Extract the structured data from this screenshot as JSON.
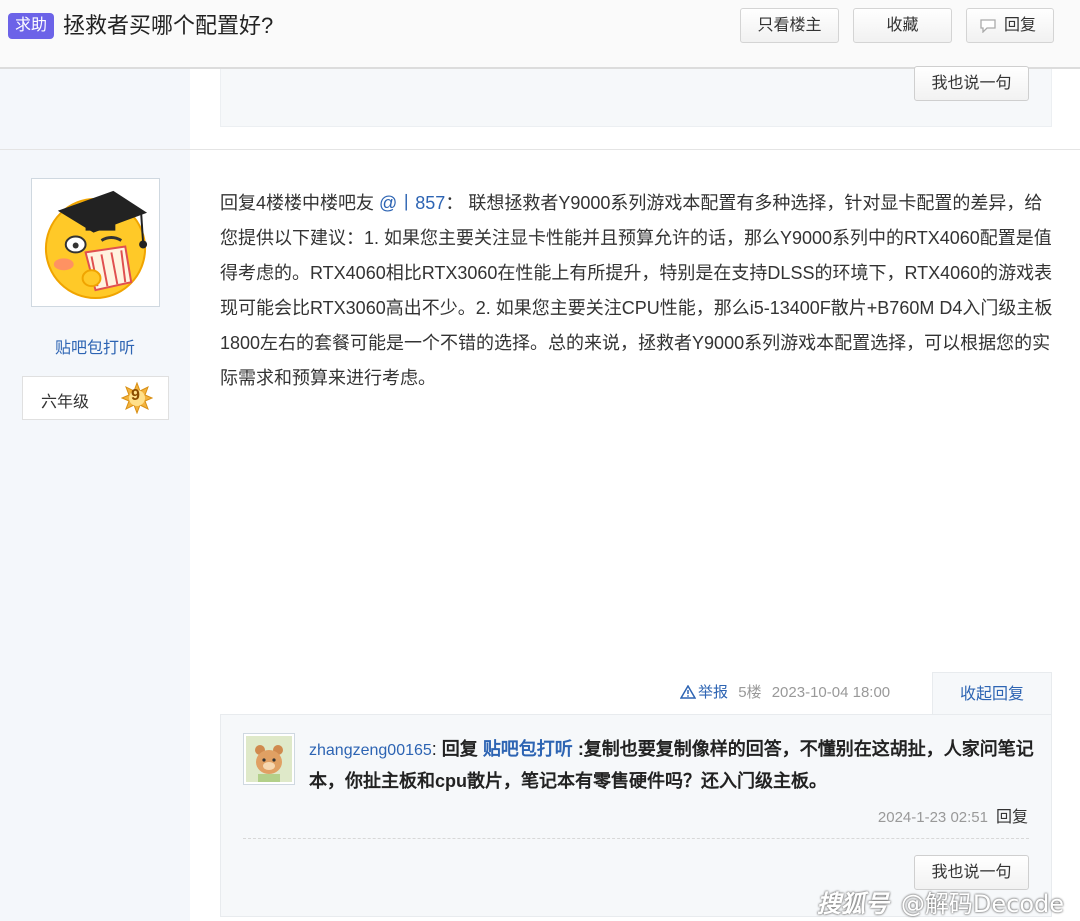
{
  "header": {
    "tag": "求助",
    "title": "拯救者买哪个配置好?",
    "only_op_label": "只看楼主",
    "favorite_label": "收藏",
    "reply_label": "回复"
  },
  "prev_post": {
    "say_label": "我也说一句"
  },
  "post": {
    "author": "贴吧包打听",
    "level_name": "六年级",
    "level_num": "9",
    "content_prefix": "回复4楼楼中楼吧友 ",
    "content_mention": "@丨857",
    "content_body": "： 联想拯救者Y9000系列游戏本配置有多种选择，针对显卡配置的差异，给您提供以下建议：1. 如果您主要关注显卡性能并且预算允许的话，那么Y9000系列中的RTX4060配置是值得考虑的。RTX4060相比RTX3060在性能上有所提升，特别是在支持DLSS的环境下，RTX4060的游戏表现可能会比RTX3060高出不少。2. 如果您主要关注CPU性能，那么i5-13400F散片+B760M D4入门级主板 1800左右的套餐可能是一个不错的选择。总的来说，拯救者Y9000系列游戏本配置选择，可以根据您的实际需求和预算来进行考虑。",
    "report_label": "举报",
    "floor": "5楼",
    "time": "2023-10-04 18:00",
    "collapse_label": "收起回复"
  },
  "sub_reply": {
    "user": "zhangzeng00165",
    "colon": ": ",
    "reply_word": "回复 ",
    "target": "贴吧包打听",
    "text": " :复制也要复制像样的回答，不懂别在这胡扯，人家问笔记本，你扯主板和cpu散片，笔记本有零售硬件吗？还入门级主板。",
    "time": "2024-1-23 02:51",
    "reply_label": "回复",
    "say_label": "我也说一句"
  },
  "watermark": {
    "logo": "搜狐号",
    "text": "@解码Decode"
  },
  "colors": {
    "accent": "#2d64b3",
    "tag_bg": "#6c63e8"
  }
}
